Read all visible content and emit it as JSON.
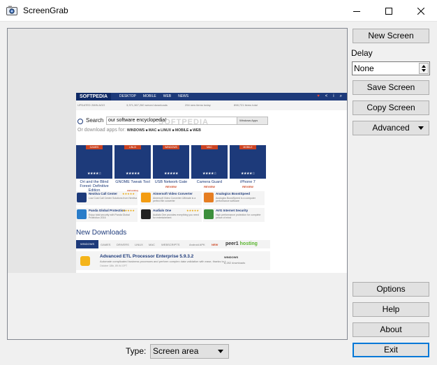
{
  "window": {
    "title": "ScreenGrab"
  },
  "controls": {
    "new_screen": "New Screen",
    "delay_label": "Delay",
    "delay_value": "None",
    "save_screen": "Save Screen",
    "copy_screen": "Copy Screen",
    "advanced": "Advanced",
    "options": "Options",
    "help": "Help",
    "about": "About",
    "exit": "Exit",
    "type_label": "Type:",
    "type_value": "Screen area"
  },
  "preview": {
    "logo": "SOFTPEDIA",
    "nav": [
      "DESKTOP",
      "MOBILE",
      "WEB",
      "NEWS"
    ],
    "stats": [
      "UPDATED 2MIN AGO",
      "3,371,367,260 served downloads",
      "294 new items today",
      "898,721 items total"
    ],
    "search_word": "Search",
    "search_value": "our software encyclopedia!",
    "search_scope": "Windows Apps",
    "or_text": "Or",
    "browse_text": "download apps for:",
    "platforms": "WINDOWS  ■ MAC  ■ LINUX  ■ MOBILE  ■ WEB",
    "watermark": "SOFTPEDIA",
    "tiles": [
      {
        "tag": "GAMES",
        "name": "Ori and the Blind Forest: Definitive Edition",
        "review": "REVIEW"
      },
      {
        "tag": "LINUX",
        "name": "GNOME Tweak Tool",
        "review": "REVIEW"
      },
      {
        "tag": "WINDOWS",
        "name": "USB Network Gate",
        "review": "REVIEW"
      },
      {
        "tag": "MAC",
        "name": "Camera Guard",
        "review": "REVIEW"
      },
      {
        "tag": "MOBILE",
        "name": "iPhone 7",
        "review": "REVIEW"
      }
    ],
    "items": [
      {
        "name": "Nextiva Call Center",
        "desc": "Low Cost Call Center Solutions from Nextiva"
      },
      {
        "name": "Ammyy Admin",
        "desc": "Easy to use remote desktop software"
      },
      {
        "name": "Panda Global Protection",
        "desc": "Enjoy total security with Panda Global Protection 2016"
      },
      {
        "name": "Audials One",
        "desc": "Audials One provides everything you need for entertainment"
      },
      {
        "name": "Aimersoft Video Converter",
        "desc": "Aimersoft Video Converter Ultimate is a perfect file converter"
      },
      {
        "name": "Analogics BoostSpeed",
        "desc": "Auslogics BoostSpeed is a computer performance software"
      },
      {
        "name": "AVG Internet Security",
        "desc": "High performance protection for complete peace of mind"
      }
    ],
    "new_downloads": "New Downloads",
    "nd_tabs": [
      "WINDOWS",
      "GAMES",
      "DRIVERS",
      "LINUX",
      "MAC",
      "WEBSCRIPTS",
      "Android APK",
      "NEW"
    ],
    "peer": "peer1",
    "hosting": "hosting",
    "nd_item": {
      "name": "Advanced ETL Processor Enterprise 5.9.3.2",
      "desc": "Automate complicated business processes and perform complex data validation with ease, thanks to t",
      "meta": "October 18th, 89.94 GPT",
      "category": "WINDOWS",
      "count": "8,282 downloads"
    }
  }
}
